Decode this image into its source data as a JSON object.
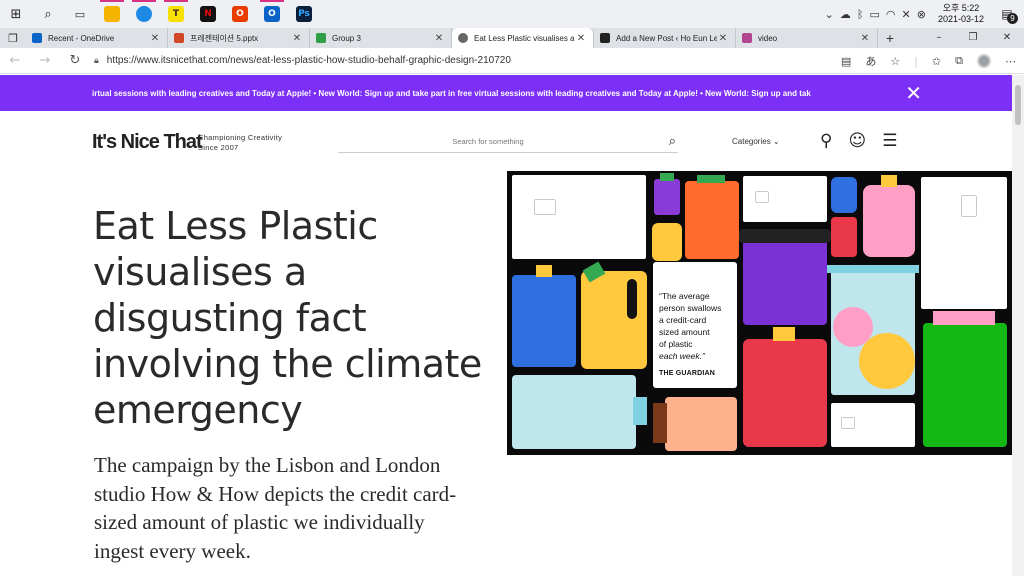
{
  "taskbar": {
    "apps": [
      {
        "icon": "windows-start-icon",
        "color": "#222222"
      },
      {
        "icon": "search-icon",
        "color": "#222222"
      },
      {
        "icon": "task-view-icon",
        "color": "#222222"
      },
      {
        "icon": "file-explorer-icon",
        "color": "#f4b400"
      },
      {
        "icon": "edge-icon",
        "color": "#1e88e5"
      },
      {
        "icon": "kakaotalk-icon",
        "color": "#f9e000"
      },
      {
        "icon": "netflix-icon",
        "color": "#e50914"
      },
      {
        "icon": "office-icon",
        "color": "#eb3c00"
      },
      {
        "icon": "outlook-icon",
        "color": "#0a64c8"
      },
      {
        "icon": "photoshop-icon",
        "color": "#0b1f3a"
      }
    ],
    "time": "오후 5:22",
    "date": "2021-03-12",
    "notification_count": "9"
  },
  "browser": {
    "tabs": [
      {
        "title": "Recent - OneDrive",
        "favicon_color": "#0a64c8",
        "active": false
      },
      {
        "title": "프레젠테이션 5.pptx",
        "favicon_color": "#d24726",
        "active": false
      },
      {
        "title": "Group 3",
        "favicon_color": "#2f9e44",
        "active": false
      },
      {
        "title": "Eat Less Plastic visualises a d",
        "favicon_color": "#666666",
        "active": true
      },
      {
        "title": "Add a New Post ‹ Ho Eun Le",
        "favicon_color": "#222222",
        "active": false
      },
      {
        "title": "video",
        "favicon_color": "#b24592",
        "active": false
      }
    ],
    "new_tab_label": "+",
    "url": "https://www.itsnicethat.com/news/eat-less-plastic-how-studio-behalf-graphic-design-210720"
  },
  "banner": {
    "text": "irtual sessions with leading creatives and Today at Apple!   •   New World: Sign up and take part in free virtual sessions with leading creatives and Today at Apple!   •   New World: Sign up and tak",
    "close_label": "✕",
    "color": "#7b2ff7"
  },
  "site": {
    "logo": "It's Nice That",
    "tagline_line1": "Championing Creativity",
    "tagline_line2": "Since 2007",
    "search_placeholder": "Search for something",
    "categories_label": "Categories ⌄"
  },
  "article": {
    "headline": "Eat Less Plastic visualises a disgusting fact involving the climate emergency",
    "standfirst": "The campaign by the Lisbon and London studio How & How depicts the credit card-sized amount of plastic we individually ingest every week."
  },
  "hero": {
    "quote_lines": [
      "“The average",
      "person swallows",
      "a credit-card",
      "sized amount",
      "of plastic",
      "each week.”"
    ],
    "quote_source": "THE GUARDIAN"
  }
}
